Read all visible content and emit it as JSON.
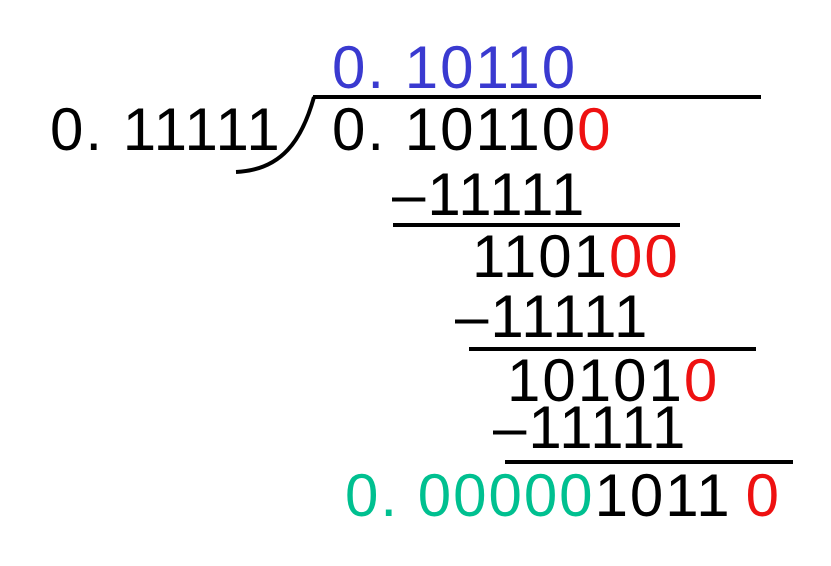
{
  "quotient": "0. 10110",
  "divisor": "0. 11111",
  "dividend": {
    "main": "0. 10110",
    "pad": "0"
  },
  "steps": [
    {
      "subtrahend": "–11111",
      "remainder": "1101",
      "pad": "00"
    },
    {
      "subtrahend": "–11111",
      "remainder": "10101",
      "pad": "0"
    },
    {
      "subtrahend": "–11111"
    }
  ],
  "final": {
    "zeros": "0. 00000",
    "rest": "1011",
    "pad": "0"
  },
  "colors": {
    "quotient": "#3a3ad0",
    "pad": "#ee1111",
    "final_zeros": "#00c090",
    "text": "#000000"
  }
}
